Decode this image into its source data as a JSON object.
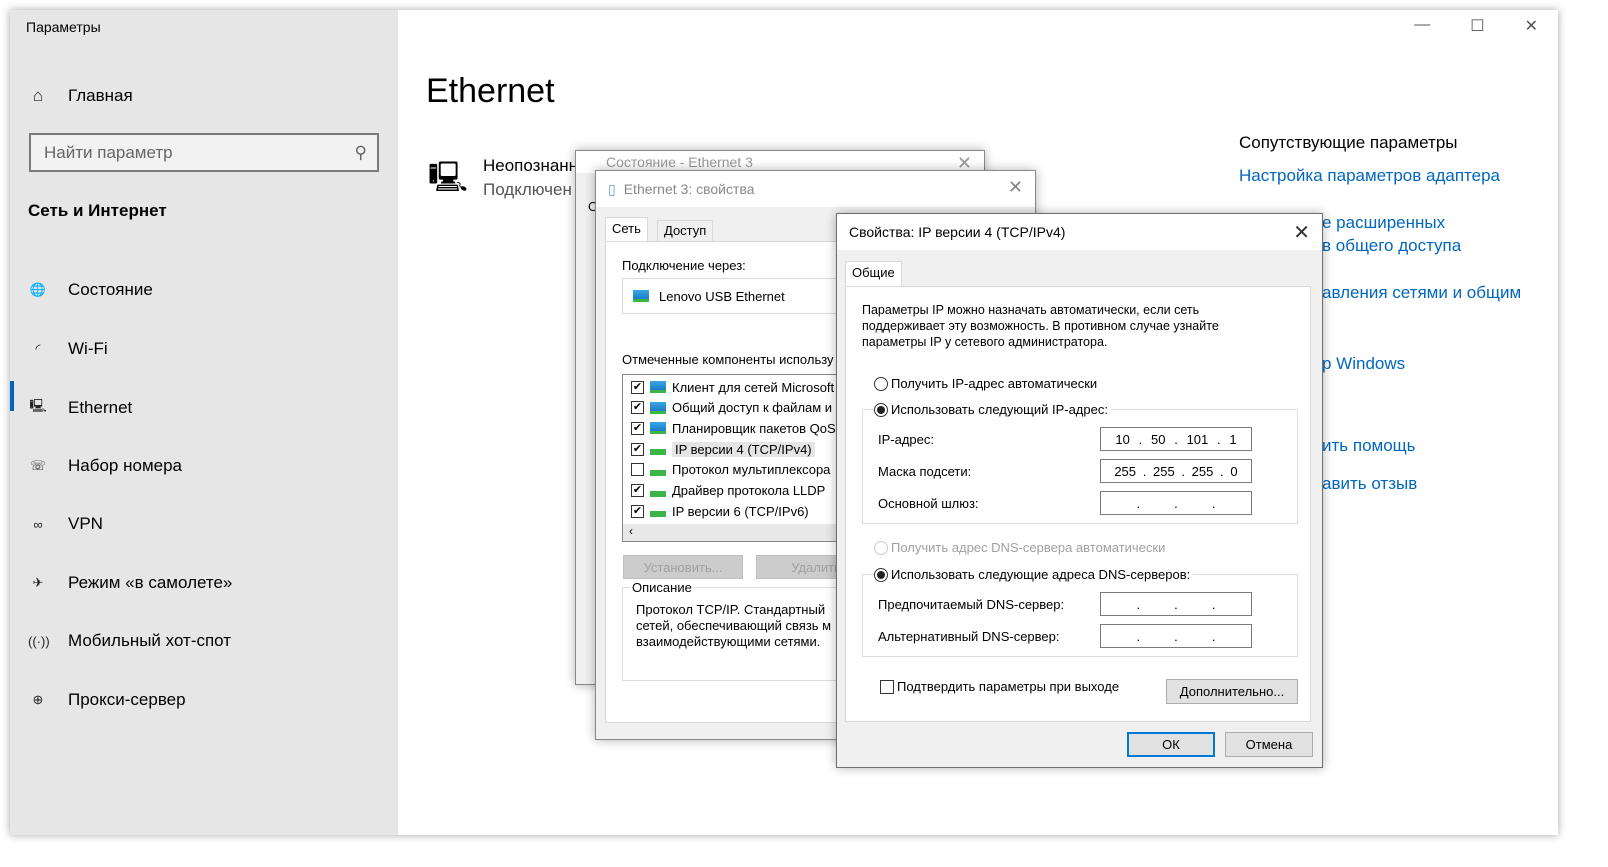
{
  "window": {
    "title": "Параметры",
    "minimize": "—",
    "maximize": "☐",
    "close": "✕"
  },
  "sidebar": {
    "home": "Главная",
    "search_placeholder": "Найти параметр",
    "section": "Сеть и Интернет",
    "items": [
      {
        "label": "Состояние",
        "icon": "globe-icon",
        "glyph": "🌐"
      },
      {
        "label": "Wi-Fi",
        "icon": "wifi-icon",
        "glyph": "◜"
      },
      {
        "label": "Ethernet",
        "icon": "ethernet-icon",
        "glyph": "🖳"
      },
      {
        "label": "Набор номера",
        "icon": "dialup-icon",
        "glyph": "☏"
      },
      {
        "label": "VPN",
        "icon": "vpn-icon",
        "glyph": "∞"
      },
      {
        "label": "Режим «в самолете»",
        "icon": "airplane-icon",
        "glyph": "✈"
      },
      {
        "label": "Мобильный хот-спот",
        "icon": "hotspot-icon",
        "glyph": "((·))"
      },
      {
        "label": "Прокси-сервер",
        "icon": "proxy-globe-icon",
        "glyph": "⊕"
      }
    ],
    "active": "Ethernet"
  },
  "main": {
    "title": "Ethernet",
    "network_name": "Неопознанн",
    "network_status": "Подключен",
    "related_title": "Сопутствующие параметры",
    "adapter_link": "Настройка параметров адаптера",
    "partial_links": [
      "е расширенных",
      "в общего доступа",
      "авления сетями и общим",
      "р Windows",
      "ить помощь",
      "авить отзыв"
    ]
  },
  "status_dialog": {
    "title": "Состояние - Ethernet 3",
    "tab_fragment": "О"
  },
  "props_dialog": {
    "title": "Ethernet 3: свойства",
    "tabs": [
      "Сеть",
      "Доступ"
    ],
    "connect_via_label": "Подключение через:",
    "adapter": "Lenovo USB Ethernet",
    "components_label": "Отмеченные компоненты использу",
    "components": [
      {
        "label": "Клиент для сетей Microsoft",
        "checked": true,
        "kind": "nic"
      },
      {
        "label": "Общий доступ к файлам и",
        "checked": true,
        "kind": "nic"
      },
      {
        "label": "Планировщик пакетов QoS",
        "checked": true,
        "kind": "nic"
      },
      {
        "label": "IP версии 4 (TCP/IPv4)",
        "checked": true,
        "kind": "proto",
        "selected": true
      },
      {
        "label": "Протокол мультиплексора",
        "checked": false,
        "kind": "proto"
      },
      {
        "label": "Драйвер протокола LLDP",
        "checked": true,
        "kind": "proto"
      },
      {
        "label": "IP версии 6 (TCP/IPv6)",
        "checked": true,
        "kind": "proto"
      }
    ],
    "install_button": "Установить...",
    "remove_button": "Удалить",
    "description_label": "Описание",
    "description": "Протокол TCP/IP. Стандартный сетей, обеспечивающий связь м взаимодействующими сетями."
  },
  "ipv4_dialog": {
    "title": "Свойства: IP версии 4 (TCP/IPv4)",
    "tab": "Общие",
    "intro": "Параметры IP можно назначать автоматически, если сеть поддерживает эту возможность. В противном случае узнайте параметры IP у сетевого администратора.",
    "auto_ip": "Получить IP-адрес автоматически",
    "manual_ip": "Использовать следующий IP-адрес:",
    "ip_selected": "manual",
    "ip_label": "IP-адрес:",
    "ip_value": [
      "10",
      "50",
      "101",
      "1"
    ],
    "mask_label": "Маска подсети:",
    "mask_value": [
      "255",
      "255",
      "255",
      "0"
    ],
    "gateway_label": "Основной шлюз:",
    "gateway_value": [
      "",
      "",
      "",
      ""
    ],
    "auto_dns": "Получить адрес DNS-сервера автоматически",
    "manual_dns": "Использовать следующие адреса DNS-серверов:",
    "dns_selected": "manual",
    "preferred_dns_label": "Предпочитаемый DNS-сервер:",
    "alternate_dns_label": "Альтернативный DNS-сервер:",
    "validate_label": "Подтвердить параметры при выходе",
    "validate_checked": false,
    "advanced_button": "Дополнительно...",
    "ok_button": "ОК",
    "cancel_button": "Отмена"
  }
}
